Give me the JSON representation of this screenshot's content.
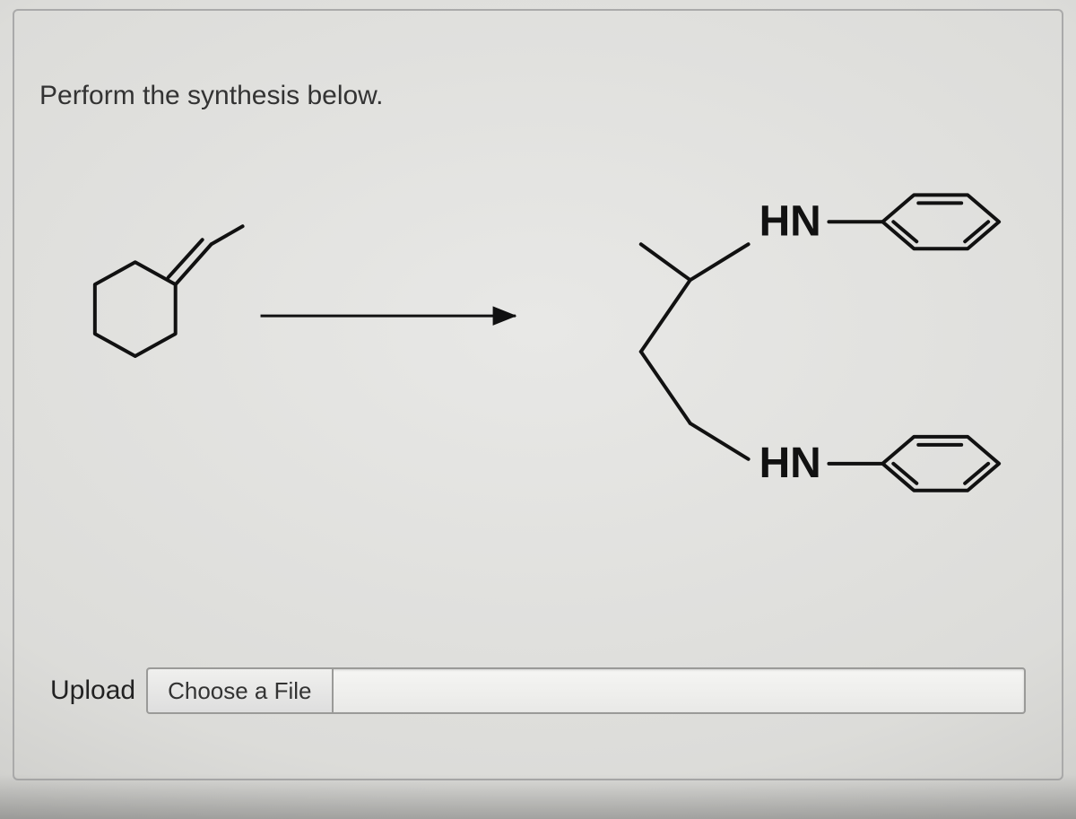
{
  "prompt": "Perform the synthesis below.",
  "labels": {
    "hn1": "HN",
    "hn2": "HN"
  },
  "upload": {
    "label": "Upload",
    "button": "Choose a File"
  }
}
